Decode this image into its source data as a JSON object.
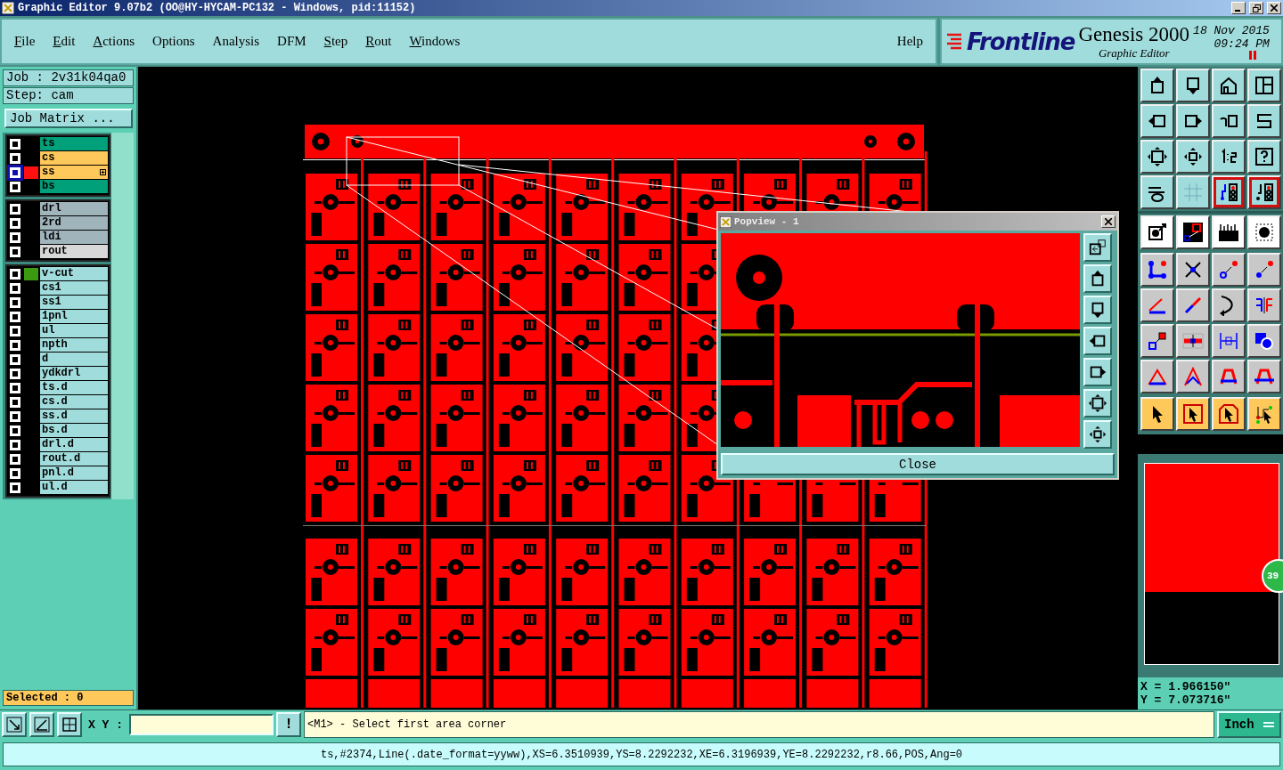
{
  "window": {
    "title": "Graphic Editor 9.07b2 (OO@HY-HYCAM-PC132 - Windows, pid:11152)"
  },
  "menu": [
    {
      "label": "File",
      "underlined": true
    },
    {
      "label": "Edit",
      "underlined": true
    },
    {
      "label": "Actions",
      "underlined": true
    },
    {
      "label": "Options",
      "underlined": false
    },
    {
      "label": "Analysis",
      "underlined": false
    },
    {
      "label": "DFM",
      "underlined": false
    },
    {
      "label": "Step",
      "underlined": true
    },
    {
      "label": "Rout",
      "underlined": true
    },
    {
      "label": "Windows",
      "underlined": true
    }
  ],
  "help": "Help",
  "brand": {
    "logo": "Frontline",
    "product": "Genesis 2000",
    "subtitle": "Graphic Editor",
    "date": "18 Nov 2015",
    "time": "09:24 PM"
  },
  "job": "Job : 2v31k04qa0",
  "step": "Step: cam",
  "job_matrix_button": "Job Matrix ...",
  "layer_groups": [
    [
      {
        "name": "ts",
        "color": "#00a07a",
        "work_layer": false
      },
      {
        "name": "cs",
        "color": "#ffc85a",
        "work_layer": false
      },
      {
        "name": "ss",
        "color": "#ffc85a",
        "work_layer": true,
        "swatch": {
          "color": "#ff1010"
        }
      },
      {
        "name": "bs",
        "color": "#00a07a",
        "work_layer": false
      }
    ],
    [
      {
        "name": "drl",
        "color": "#a0b4bc",
        "work_layer": false
      },
      {
        "name": "2rd",
        "color": "#a0b4bc",
        "work_layer": false
      },
      {
        "name": "ldi",
        "color": "#a0b4bc",
        "work_layer": false
      },
      {
        "name": "rout",
        "color": "#d8d8d8",
        "work_layer": false
      }
    ],
    [
      {
        "name": "v-cut",
        "color": "#a0dcdc",
        "work_layer": false,
        "swatch": {
          "color": "#3c9a10"
        }
      },
      {
        "name": "cs1",
        "color": "#a0dcdc",
        "work_layer": false
      },
      {
        "name": "ss1",
        "color": "#a0dcdc",
        "work_layer": false
      },
      {
        "name": "1pnl",
        "color": "#a0dcdc",
        "work_layer": false
      },
      {
        "name": "ul",
        "color": "#a0dcdc",
        "work_layer": false
      },
      {
        "name": "npth",
        "color": "#a0dcdc",
        "work_layer": false
      },
      {
        "name": "d",
        "color": "#a0dcdc",
        "work_layer": false
      },
      {
        "name": "ydkdrl",
        "color": "#a0dcdc",
        "work_layer": false
      },
      {
        "name": "ts.d",
        "color": "#a0dcdc",
        "work_layer": false
      },
      {
        "name": "cs.d",
        "color": "#a0dcdc",
        "work_layer": false
      },
      {
        "name": "ss.d",
        "color": "#a0dcdc",
        "work_layer": false
      },
      {
        "name": "bs.d",
        "color": "#a0dcdc",
        "work_layer": false
      },
      {
        "name": "drl.d",
        "color": "#a0dcdc",
        "work_layer": false
      },
      {
        "name": "rout.d",
        "color": "#a0dcdc",
        "work_layer": false
      },
      {
        "name": "pnl.d",
        "color": "#a0dcdc",
        "work_layer": false
      },
      {
        "name": "ul.d",
        "color": "#a0dcdc",
        "work_layer": false
      }
    ]
  ],
  "selected_count": "Selected : 0",
  "toolbar": [
    {
      "kind": "view",
      "buttons": [
        {
          "kind": "pan-up",
          "on": false
        },
        {
          "kind": "pan-down",
          "on": false
        },
        {
          "kind": "home",
          "on": false
        },
        {
          "kind": "grid-window",
          "on": false
        },
        {
          "kind": "pan-left",
          "on": false
        },
        {
          "kind": "pan-right",
          "on": false
        },
        {
          "kind": "undo-view",
          "on": false
        },
        {
          "kind": "snake",
          "on": false
        },
        {
          "kind": "zoom-fit",
          "on": false
        },
        {
          "kind": "zoom-center",
          "on": false
        },
        {
          "kind": "scale",
          "on": false
        },
        {
          "kind": "help",
          "on": false
        },
        {
          "kind": "tools",
          "on": false
        },
        {
          "kind": "grid",
          "on": false
        },
        {
          "kind": "net",
          "on": true
        },
        {
          "kind": "net2",
          "on": true
        }
      ]
    },
    {
      "kind": "display",
      "buttons": [
        {
          "kind": "pad-select",
          "on": false
        },
        {
          "kind": "area",
          "on": false
        },
        {
          "kind": "ruler",
          "on": false
        },
        {
          "kind": "pad",
          "on": false
        }
      ]
    },
    {
      "kind": "edit",
      "buttons": [
        {
          "kind": "nodes",
          "on": false
        },
        {
          "kind": "cross",
          "on": false
        },
        {
          "kind": "link-hollow",
          "on": false
        },
        {
          "kind": "link-solid",
          "on": false
        },
        {
          "kind": "slope",
          "on": false
        },
        {
          "kind": "line-move",
          "on": false
        },
        {
          "kind": "rotate",
          "on": false
        },
        {
          "kind": "mirror",
          "on": false
        },
        {
          "kind": "pad-move",
          "on": false
        },
        {
          "kind": "line-seg",
          "on": false
        },
        {
          "kind": "measure",
          "on": false
        },
        {
          "kind": "shapes",
          "on": false
        },
        {
          "kind": "triangle",
          "on": false
        },
        {
          "kind": "peak",
          "on": false
        },
        {
          "kind": "arch",
          "on": false
        },
        {
          "kind": "arch-cross",
          "on": false
        }
      ]
    },
    {
      "kind": "select",
      "buttons": [
        {
          "kind": "pointer",
          "on": false
        },
        {
          "kind": "pointer-box",
          "on": false
        },
        {
          "kind": "pointer-oct",
          "on": false
        },
        {
          "kind": "pointer-net",
          "on": false
        }
      ]
    }
  ],
  "overview_badge": "39",
  "coordinates": {
    "x": "X = 1.966150\"",
    "y": "Y = 7.073716\""
  },
  "popview": {
    "title": "Popview - 1",
    "close_button": "Close",
    "tools": [
      {
        "kind": "popout"
      },
      {
        "kind": "pan-up"
      },
      {
        "kind": "pan-down"
      },
      {
        "kind": "pan-left"
      },
      {
        "kind": "pan-right"
      },
      {
        "kind": "zoom-fit"
      },
      {
        "kind": "zoom-center"
      }
    ]
  },
  "command_bar": {
    "xy_label": "X Y :",
    "alert_button": "!",
    "message": "<M1> - Select first area corner",
    "units": "Inch"
  },
  "status_line": "ts,#2374,Line(.date_format=yyww),XS=6.3510939,YS=8.2292232,XE=6.3196939,YE=8.2292232,r8.66,POS,Ang=0"
}
